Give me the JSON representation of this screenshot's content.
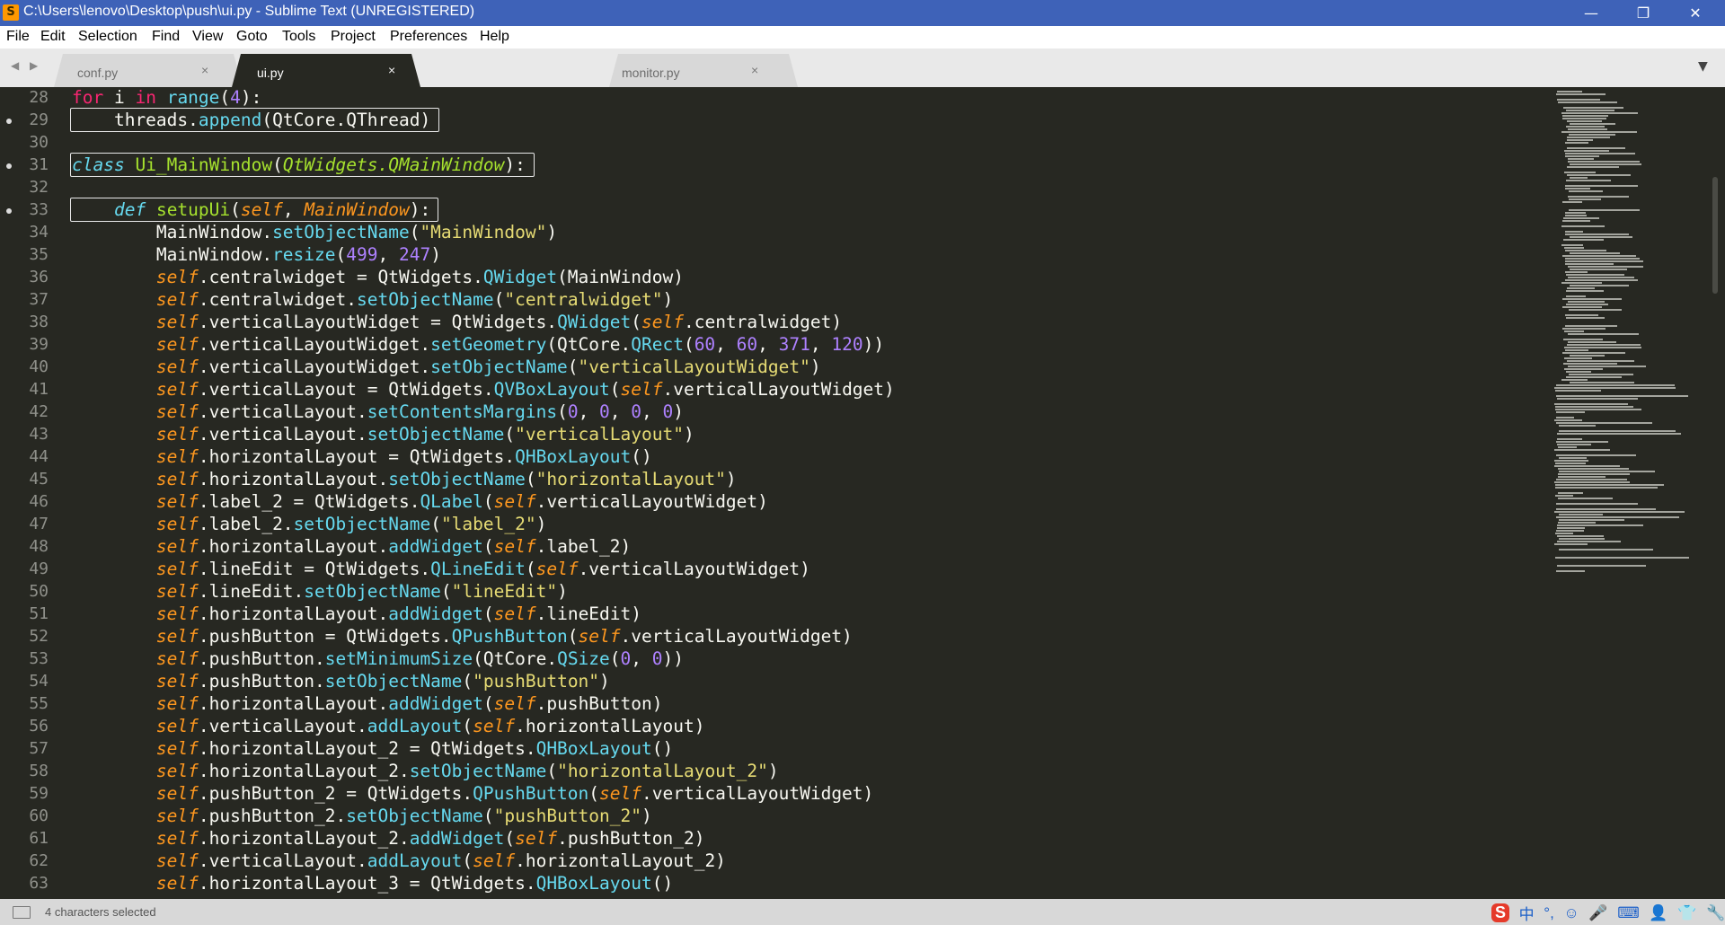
{
  "window": {
    "title": "C:\\Users\\lenovo\\Desktop\\push\\ui.py - Sublime Text (UNREGISTERED)",
    "app_icon": "S",
    "controls": [
      "—",
      "❐",
      "✕"
    ]
  },
  "menu": [
    "File",
    "Edit",
    "Selection",
    "Find",
    "View",
    "Goto",
    "Tools",
    "Project",
    "Preferences",
    "Help"
  ],
  "tabs": [
    {
      "label": "conf.py",
      "close": "×",
      "active": false
    },
    {
      "label": "ui.py",
      "close": "×",
      "active": true
    },
    {
      "label": "monitor.py",
      "close": "×",
      "active": false
    }
  ],
  "tab_nav": "◀ ▶",
  "tab_dropdown": "▼",
  "editor": {
    "line_numbers": [
      "28",
      "29",
      "30",
      "31",
      "32",
      "33",
      "34",
      "35",
      "36",
      "37",
      "38",
      "39",
      "40",
      "41",
      "42",
      "43",
      "44",
      "45",
      "46",
      "47",
      "48",
      "49",
      "50",
      "51",
      "52",
      "53",
      "54",
      "55",
      "56",
      "57",
      "58",
      "59",
      "60",
      "61",
      "62",
      "63"
    ],
    "modified_marker_lines": [
      "29",
      "31",
      "33"
    ],
    "highlight_colors": {
      "keyword": "#f92672",
      "function": "#66d9ef",
      "number": "#ae81ff",
      "string": "#e6db74",
      "self": "#fd971f",
      "class_name": "#a6e22e",
      "background": "#272822"
    }
  },
  "status": {
    "text": "4 characters selected",
    "tray_icons": [
      "S",
      "中",
      "°,",
      "☺",
      "🎤",
      "⌨",
      "👤",
      "👕",
      "🔧"
    ]
  }
}
